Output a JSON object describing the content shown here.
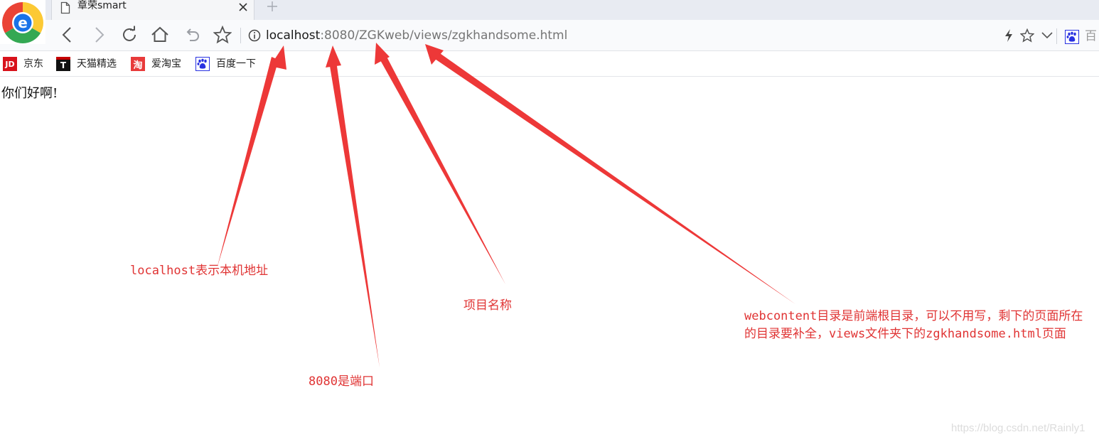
{
  "browser": {
    "tab": {
      "title": "章荣smart"
    },
    "address": {
      "host": "localhost",
      "rest": ":8080/ZGKweb/views/zgkhandsome.html"
    },
    "search_engine_label": "百"
  },
  "bookmarks": [
    {
      "label": "京东",
      "icon_text": "JD",
      "color": "#d8121b"
    },
    {
      "label": "天猫精选",
      "icon_text": "T",
      "color": "#c40000"
    },
    {
      "label": "爱淘宝",
      "icon_text": "淘",
      "color": "#e83a3a"
    },
    {
      "label": "百度一下",
      "icon_text": "",
      "color": "#2932e1"
    }
  ],
  "page": {
    "text": "你们好啊!"
  },
  "annotations": {
    "localhost": "localhost表示本机地址",
    "port": "8080是端口",
    "project": "项目名称",
    "webcontent": "webcontent目录是前端根目录，可以不用写，剩下的页面所在的目录要补全，views文件夹下的zgkhandsome.html页面",
    "color": "#e83a3a"
  },
  "watermark": "https://blog.csdn.net/Rainly1"
}
